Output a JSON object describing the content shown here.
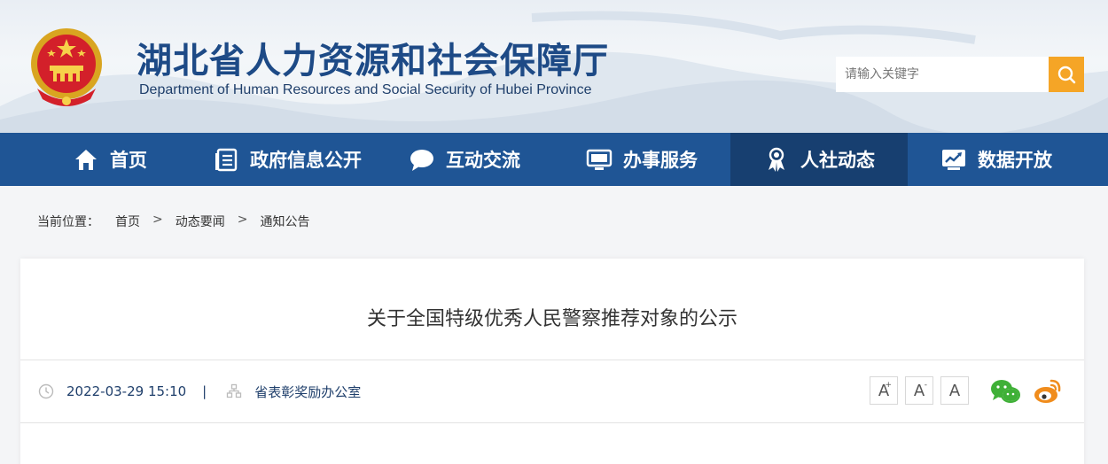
{
  "header": {
    "title": "湖北省人力资源和社会保障厅",
    "subtitle": "Department of Human Resources and Social Security of Hubei Province",
    "emblem_icon": "national-emblem-icon"
  },
  "search": {
    "placeholder": "请输入关键字",
    "button_icon": "search-icon"
  },
  "nav": {
    "items": [
      {
        "label": "首页",
        "icon": "home-icon"
      },
      {
        "label": "政府信息公开",
        "icon": "document-list-icon"
      },
      {
        "label": "互动交流",
        "icon": "chat-bubble-icon"
      },
      {
        "label": "办事服务",
        "icon": "monitor-icon"
      },
      {
        "label": "人社动态",
        "icon": "award-person-icon",
        "active": true
      },
      {
        "label": "数据开放",
        "icon": "chart-screen-icon"
      }
    ]
  },
  "breadcrumb": {
    "prefix": "当前位置：",
    "items": [
      "首页",
      "动态要闻",
      "通知公告"
    ],
    "separator": ">"
  },
  "article": {
    "title": "关于全国特级优秀人民警察推荐对象的公示",
    "datetime": "2022-03-29 15:10",
    "meta_separator": "|",
    "source": "省表彰奖励办公室"
  },
  "font_controls": {
    "increase": "A",
    "increase_mark": "+",
    "decrease": "A",
    "decrease_mark": "-",
    "reset": "A"
  },
  "share": {
    "wechat_icon": "wechat-icon",
    "weibo_icon": "weibo-icon"
  },
  "colors": {
    "nav_bg": "#1f5595",
    "nav_active": "#173f70",
    "title_blue": "#1d4a86",
    "search_accent": "#f5a526",
    "wechat": "#3fb037",
    "weibo": "#f08c1c"
  }
}
